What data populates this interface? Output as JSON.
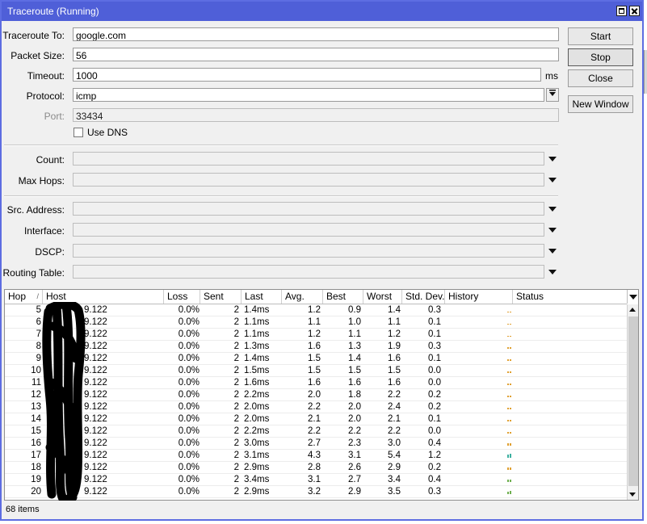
{
  "window": {
    "title": "Traceroute (Running)"
  },
  "form": {
    "traceroute_to": {
      "label": "Traceroute To:",
      "value": "google.com"
    },
    "packet_size": {
      "label": "Packet Size:",
      "value": "56"
    },
    "timeout": {
      "label": "Timeout:",
      "value": "1000",
      "unit": "ms"
    },
    "protocol": {
      "label": "Protocol:",
      "value": "icmp"
    },
    "port": {
      "label": "Port:",
      "value": "33434"
    },
    "use_dns": {
      "label": "Use DNS",
      "checked": false
    },
    "count": {
      "label": "Count:",
      "value": ""
    },
    "max_hops": {
      "label": "Max Hops:",
      "value": ""
    },
    "src_address": {
      "label": "Src. Address:",
      "value": ""
    },
    "interface": {
      "label": "Interface:",
      "value": ""
    },
    "dscp": {
      "label": "DSCP:",
      "value": ""
    },
    "routing_table": {
      "label": "Routing Table:",
      "value": ""
    }
  },
  "buttons": {
    "start": "Start",
    "stop": "Stop",
    "close": "Close",
    "new_window": "New Window"
  },
  "table": {
    "columns": [
      "Hop",
      "Host",
      "Loss",
      "Sent",
      "Last",
      "Avg.",
      "Best",
      "Worst",
      "Std. Dev.",
      "History",
      "Status"
    ],
    "sort_indicator": "/",
    "rows": [
      {
        "hop": "5",
        "host": "9.122",
        "loss": "0.0%",
        "sent": "2",
        "last": "1.4ms",
        "avg": "1.2",
        "best": "0.9",
        "worst": "1.4",
        "stdev": "0.3"
      },
      {
        "hop": "6",
        "host": "9.122",
        "loss": "0.0%",
        "sent": "2",
        "last": "1.1ms",
        "avg": "1.1",
        "best": "1.0",
        "worst": "1.1",
        "stdev": "0.1"
      },
      {
        "hop": "7",
        "host": "9.122",
        "loss": "0.0%",
        "sent": "2",
        "last": "1.1ms",
        "avg": "1.2",
        "best": "1.1",
        "worst": "1.2",
        "stdev": "0.1"
      },
      {
        "hop": "8",
        "host": "9.122",
        "loss": "0.0%",
        "sent": "2",
        "last": "1.3ms",
        "avg": "1.6",
        "best": "1.3",
        "worst": "1.9",
        "stdev": "0.3"
      },
      {
        "hop": "9",
        "host": "9.122",
        "loss": "0.0%",
        "sent": "2",
        "last": "1.4ms",
        "avg": "1.5",
        "best": "1.4",
        "worst": "1.6",
        "stdev": "0.1"
      },
      {
        "hop": "10",
        "host": "9.122",
        "loss": "0.0%",
        "sent": "2",
        "last": "1.5ms",
        "avg": "1.5",
        "best": "1.5",
        "worst": "1.5",
        "stdev": "0.0"
      },
      {
        "hop": "11",
        "host": "9.122",
        "loss": "0.0%",
        "sent": "2",
        "last": "1.6ms",
        "avg": "1.6",
        "best": "1.6",
        "worst": "1.6",
        "stdev": "0.0"
      },
      {
        "hop": "12",
        "host": "9.122",
        "loss": "0.0%",
        "sent": "2",
        "last": "2.2ms",
        "avg": "2.0",
        "best": "1.8",
        "worst": "2.2",
        "stdev": "0.2"
      },
      {
        "hop": "13",
        "host": "9.122",
        "loss": "0.0%",
        "sent": "2",
        "last": "2.0ms",
        "avg": "2.2",
        "best": "2.0",
        "worst": "2.4",
        "stdev": "0.2"
      },
      {
        "hop": "14",
        "host": "9.122",
        "loss": "0.0%",
        "sent": "2",
        "last": "2.0ms",
        "avg": "2.1",
        "best": "2.0",
        "worst": "2.1",
        "stdev": "0.1"
      },
      {
        "hop": "15",
        "host": "9.122",
        "loss": "0.0%",
        "sent": "2",
        "last": "2.2ms",
        "avg": "2.2",
        "best": "2.2",
        "worst": "2.2",
        "stdev": "0.0"
      },
      {
        "hop": "16",
        "host": "9.122",
        "loss": "0.0%",
        "sent": "2",
        "last": "3.0ms",
        "avg": "2.7",
        "best": "2.3",
        "worst": "3.0",
        "stdev": "0.4"
      },
      {
        "hop": "17",
        "host": "9.122",
        "loss": "0.0%",
        "sent": "2",
        "last": "3.1ms",
        "avg": "4.3",
        "best": "3.1",
        "worst": "5.4",
        "stdev": "1.2"
      },
      {
        "hop": "18",
        "host": "9.122",
        "loss": "0.0%",
        "sent": "2",
        "last": "2.9ms",
        "avg": "2.8",
        "best": "2.6",
        "worst": "2.9",
        "stdev": "0.2"
      },
      {
        "hop": "19",
        "host": "9.122",
        "loss": "0.0%",
        "sent": "2",
        "last": "3.4ms",
        "avg": "3.1",
        "best": "2.7",
        "worst": "3.4",
        "stdev": "0.4"
      },
      {
        "hop": "20",
        "host": "9.122",
        "loss": "0.0%",
        "sent": "2",
        "last": "2.9ms",
        "avg": "3.2",
        "best": "2.9",
        "worst": "3.5",
        "stdev": "0.3"
      }
    ]
  },
  "colors": {
    "title_bar": "#4f5fd8",
    "history_low": "#e0a030",
    "history_high": "#3cb0a0",
    "history_mid": "#70b050"
  },
  "status_bar": {
    "count": "68 items"
  }
}
